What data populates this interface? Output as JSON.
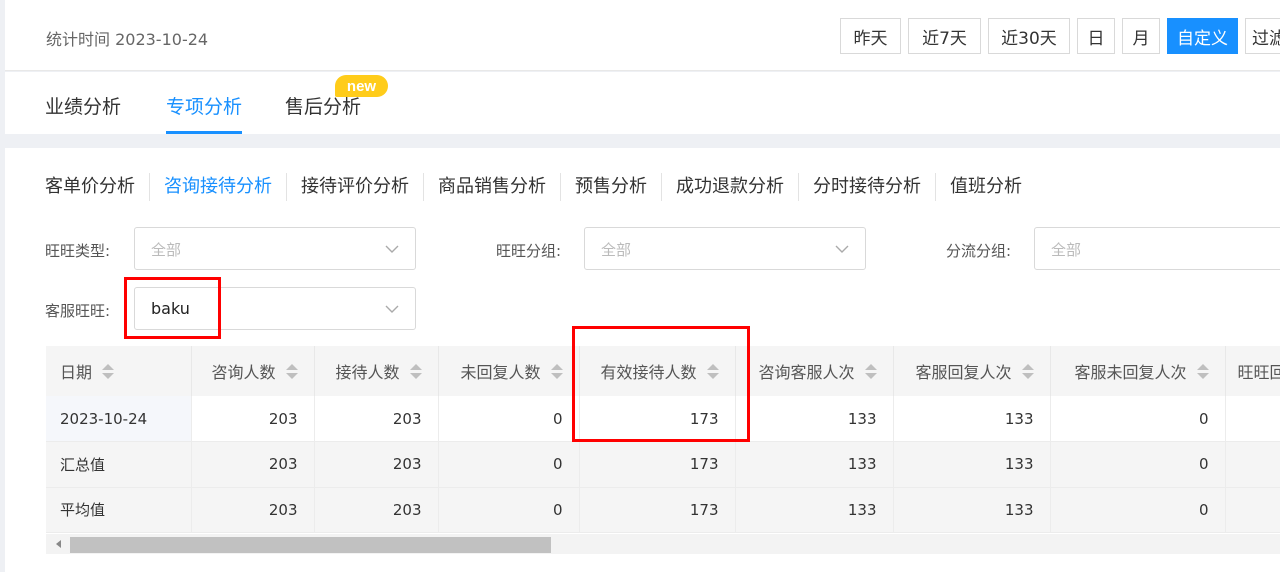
{
  "header": {
    "stat_time": "统计时间 2023-10-24",
    "range_buttons": [
      "昨天",
      "近7天",
      "近30天",
      "日",
      "月",
      "自定义",
      "过滤"
    ],
    "active_range": "自定义"
  },
  "main_tabs": {
    "items": [
      "业绩分析",
      "专项分析",
      "售后分析"
    ],
    "active": "专项分析",
    "badge": "new"
  },
  "sub_tabs": {
    "items": [
      "客单价分析",
      "咨询接待分析",
      "接待评价分析",
      "商品销售分析",
      "预售分析",
      "成功退款分析",
      "分时接待分析",
      "值班分析"
    ],
    "active": "咨询接待分析"
  },
  "filters": {
    "wangwang_type": {
      "label": "旺旺类型:",
      "placeholder": "全部"
    },
    "wangwang_group": {
      "label": "旺旺分组:",
      "placeholder": "全部"
    },
    "split_group": {
      "label": "分流分组:",
      "placeholder": "全部"
    },
    "service_wangwang": {
      "label": "客服旺旺:",
      "value": "baku"
    }
  },
  "table": {
    "headers": [
      "日期",
      "咨询人数",
      "接待人数",
      "未回复人数",
      "有效接待人数",
      "咨询客服人次",
      "客服回复人次",
      "客服未回复人次",
      "旺旺回"
    ],
    "rows": [
      [
        "2023-10-24",
        "203",
        "203",
        "0",
        "173",
        "133",
        "133",
        "0",
        ""
      ],
      [
        "汇总值",
        "203",
        "203",
        "0",
        "173",
        "133",
        "133",
        "0",
        ""
      ],
      [
        "平均值",
        "203",
        "203",
        "0",
        "173",
        "133",
        "133",
        "0",
        ""
      ]
    ]
  },
  "colors": {
    "accent": "#1890ff",
    "badge": "#ffcc1a",
    "highlight": "#ff0000"
  }
}
